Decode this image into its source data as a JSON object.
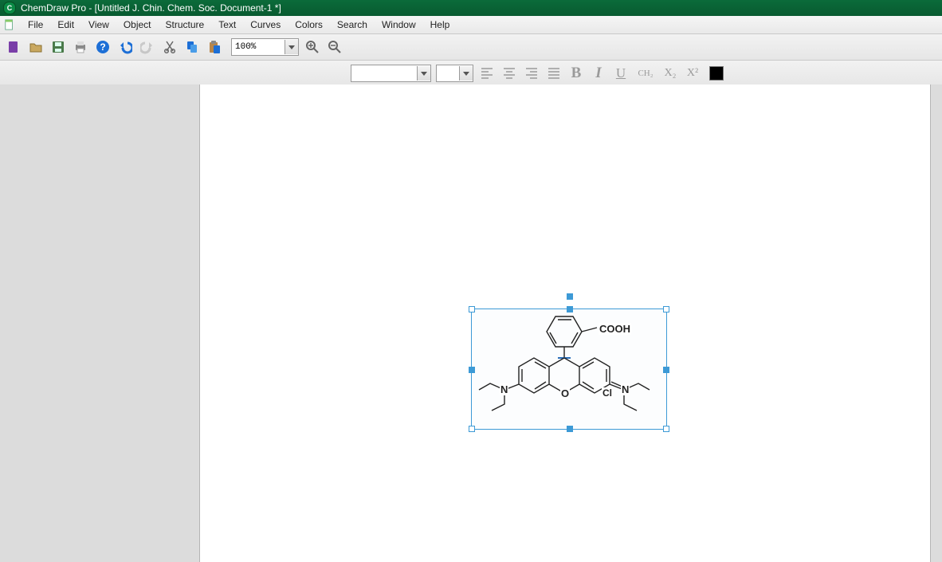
{
  "title": "ChemDraw Pro - [Untitled J. Chin. Chem. Soc. Document-1 *]",
  "menus": [
    "File",
    "Edit",
    "View",
    "Object",
    "Structure",
    "Text",
    "Curves",
    "Colors",
    "Search",
    "Window",
    "Help"
  ],
  "zoom": "100%",
  "format_buttons": {
    "bold": "B",
    "italic": "I",
    "underline": "U",
    "formula": "CH₂",
    "subscript": "X₂",
    "superscript": "X²"
  },
  "molecule_labels": {
    "cooh": "COOH",
    "n1": "N",
    "n2": "N",
    "o": "O",
    "cl": "Cl"
  }
}
